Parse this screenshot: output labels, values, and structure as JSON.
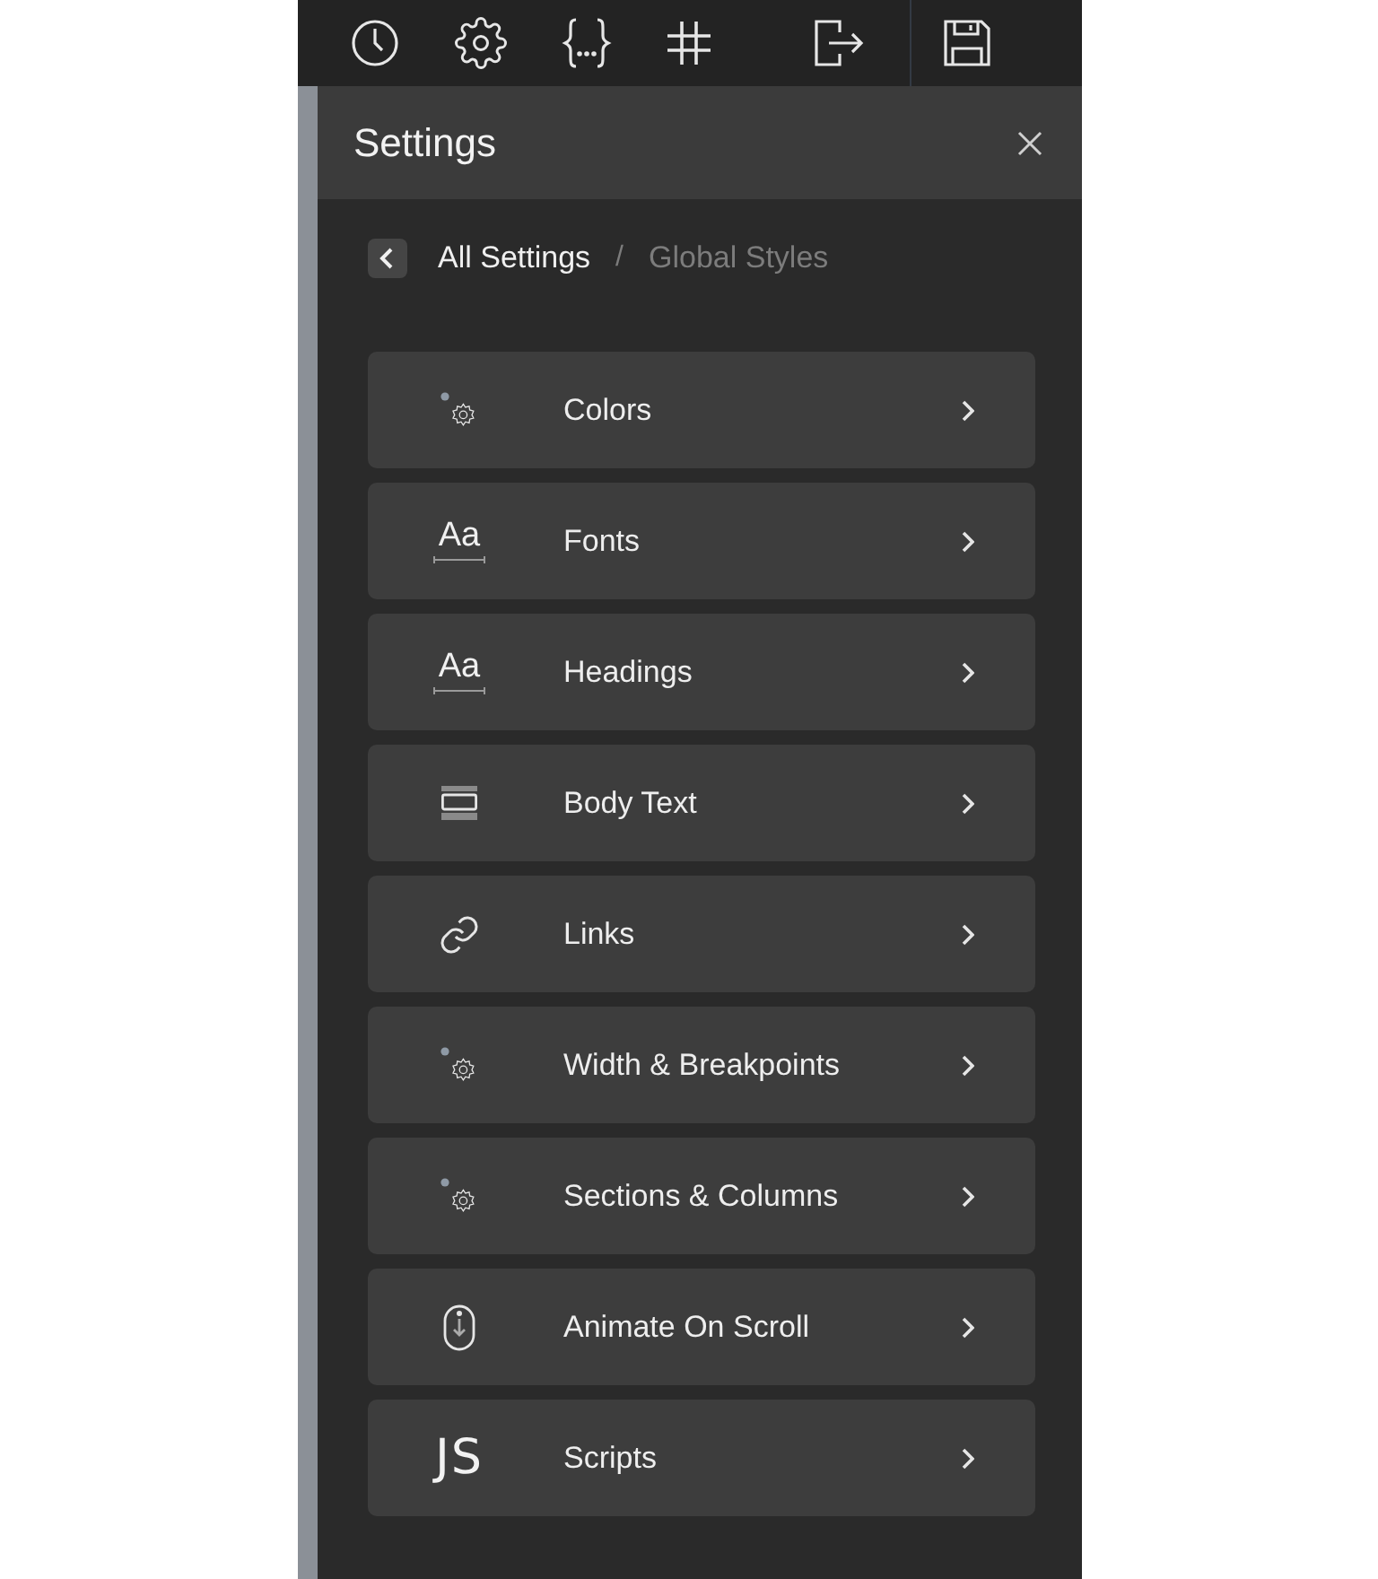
{
  "panel": {
    "title": "Settings"
  },
  "breadcrumb": [
    {
      "label": "All Settings",
      "selected": false
    },
    {
      "label": "Global Styles",
      "selected": true
    }
  ],
  "breadcrumb_separator": "/",
  "items": [
    {
      "kind": "gear",
      "label": "Colors"
    },
    {
      "kind": "font",
      "icon_text": "Aa",
      "label": "Fonts"
    },
    {
      "kind": "font",
      "icon_text": "Aa",
      "label": "Headings"
    },
    {
      "kind": "body",
      "label": "Body Text"
    },
    {
      "kind": "link",
      "label": "Links"
    },
    {
      "kind": "gear",
      "label": "Width & Breakpoints"
    },
    {
      "kind": "gear",
      "label": "Sections & Columns"
    },
    {
      "kind": "mouse",
      "label": "Animate On Scroll"
    },
    {
      "kind": "js",
      "icon_text": "JS",
      "label": "Scripts"
    }
  ]
}
